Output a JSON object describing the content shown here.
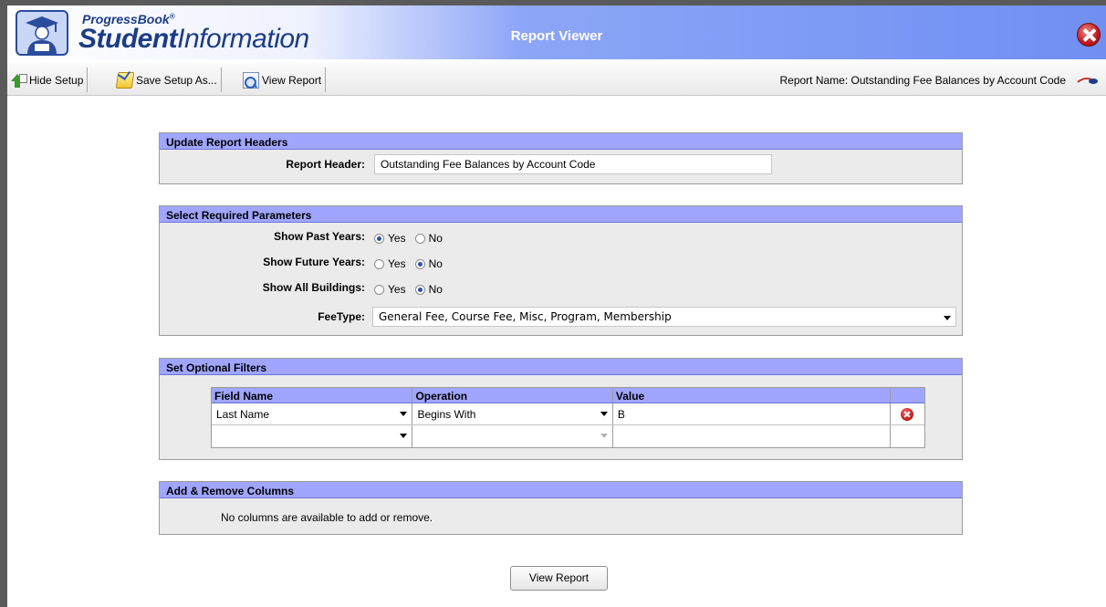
{
  "header": {
    "brand_small": "ProgressBook",
    "brand_big_bold": "Student",
    "brand_big_rest": "Information",
    "title": "Report Viewer",
    "close_icon": "close-circle-icon"
  },
  "toolbar": {
    "hide_setup": "Hide Setup",
    "save_setup_as": "Save Setup As...",
    "view_report": "View Report",
    "report_name": "Report Name:  Outstanding Fee Balances by Account Code"
  },
  "headers_panel": {
    "title": "Update Report Headers",
    "report_header_label": "Report Header:",
    "report_header_value": "Outstanding Fee Balances by Account Code"
  },
  "params_panel": {
    "title": "Select Required Parameters",
    "yes": "Yes",
    "no": "No",
    "params": [
      {
        "label": "Show Past Years:",
        "selected": "Yes"
      },
      {
        "label": "Show Future Years:",
        "selected": "No"
      },
      {
        "label": "Show All Buildings:",
        "selected": "No"
      }
    ],
    "fee_type_label": "FeeType:",
    "fee_type_value": "General Fee, Course Fee, Misc, Program, Membership"
  },
  "filters_panel": {
    "title": "Set Optional Filters",
    "columns": [
      "Field Name",
      "Operation",
      "Value"
    ],
    "rows": [
      {
        "field": "Last Name",
        "operation": "Begins With",
        "value": "B"
      },
      {
        "field": "",
        "operation": "",
        "value": ""
      }
    ]
  },
  "columns_panel": {
    "title": "Add & Remove Columns",
    "message": "No columns are available to add or remove."
  },
  "footer": {
    "view_report_button": "View Report"
  },
  "colors": {
    "panel_header": "#a0a6ff",
    "header_gradient_end": "#6f8ff2",
    "panel_bg": "#ebebeb"
  }
}
